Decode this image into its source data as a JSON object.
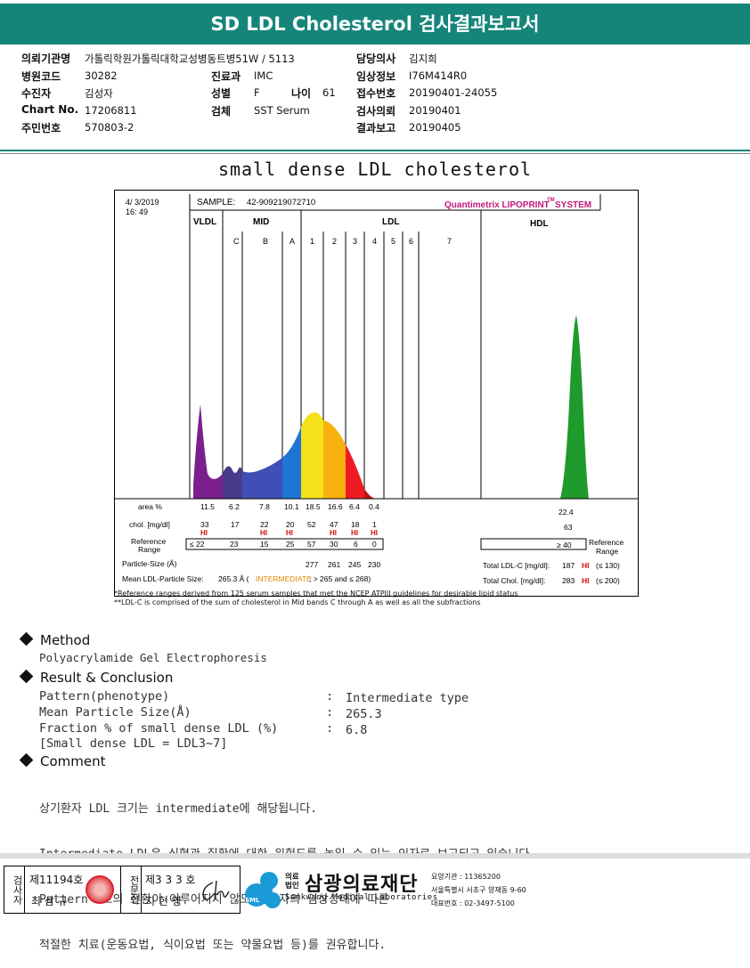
{
  "title": "SD LDL Cholesterol 검사결과보고서",
  "info": {
    "hospital_label": "의뢰기관명",
    "hospital_value": "가톨릭학원가톨릭대학교성병동트병51W / 5113",
    "doctor_label": "담당의사",
    "doctor_value": "김지희",
    "code_label": "병원코드",
    "code_value": "30282",
    "dept_label": "진료과",
    "dept_value": "IMC",
    "clinical_label": "임상정보",
    "clinical_value": "I76M414R0",
    "patient_label": "수진자",
    "patient_value": "김성자",
    "sex_label": "성별",
    "sex_value": "F",
    "age_label": "나이",
    "age_value": "61",
    "receipt_label": "접수번호",
    "receipt_value": "20190401-24055",
    "chart_label": "Chart No.",
    "chart_value": "17206811",
    "specimen_label": "검체",
    "specimen_value": "SST Serum",
    "request_label": "검사의뢰",
    "request_value": "20190401",
    "id_label": "주민번호",
    "id_value": "570803-2",
    "report_label": "결과보고",
    "report_value": "20190405"
  },
  "section_title": "small dense LDL cholesterol",
  "chart": {
    "date": "4/ 3/2019",
    "time": "16: 49",
    "sample_label": "SAMPLE:",
    "sample_value": "42-909219072710",
    "brand": "Quantimetrix LIPOPRINT",
    "brand_tm": "TM",
    "brand_system": "SYSTEM",
    "group_vldl": "VLDL",
    "group_mid": "MID",
    "group_ldl": "LDL",
    "group_hdl": "HDL",
    "band_labels": [
      "C",
      "B",
      "A",
      "1",
      "2",
      "3",
      "4",
      "5",
      "6",
      "7"
    ],
    "row_area_label": "area %",
    "area_values": [
      "11.5",
      "6.2",
      "7.8",
      "10.1",
      "18.5",
      "16.6",
      "6.4",
      "0.4"
    ],
    "area_hdl": "22.4",
    "row_chol_label": "chol. [mg/dl]",
    "chol_values": [
      "33",
      "17",
      "22",
      "20",
      "52",
      "47",
      "18",
      "1"
    ],
    "chol_hi": [
      "HI",
      "",
      "HI",
      "HI",
      "",
      "HI",
      "HI",
      "HI"
    ],
    "chol_hdl": "63",
    "row_ref_label1": "Reference",
    "row_ref_label2": "Range",
    "ref_values": [
      "≤ 22",
      "23",
      "15",
      "25",
      "57",
      "30",
      "6",
      "0"
    ],
    "ref_hdl": "≥ 40",
    "ref_right1": "Reference",
    "ref_right2": "Range",
    "particle_label": "Particle-Size (Å)",
    "particle_values": [
      "277",
      "261",
      "245",
      "230"
    ],
    "mean_label": "Mean LDL-Particle Size:",
    "mean_value": "265.3 Å (",
    "mean_type": "INTERMEDIATE",
    "mean_range": "; > 265 and ≤ 268)",
    "total_ldl_label": "Total LDL-C [mg/dl]:",
    "total_ldl_value": "187",
    "total_ldl_flag": "HI",
    "total_ldl_ref": "(≤ 130)",
    "total_chol_label": "Total Chol. [mg/dl]:",
    "total_chol_value": "283",
    "total_chol_flag": "HI",
    "total_chol_ref": "(≤ 200)",
    "note1": "*Reference ranges derived from 125 serum samples that met the NCEP ATPIII guidelines for desirable lipid status",
    "note2": "**LDL-C is comprised of the sum of cholesterol in Mid bands C through A as well as all the subfractions"
  },
  "method": {
    "heading": "Method",
    "text": "Polyacrylamide Gel Electrophoresis"
  },
  "result": {
    "heading": "Result & Conclusion",
    "pattern_label": "Pattern(phenotype)",
    "pattern_value": "Intermediate type",
    "mean_label": "Mean Particle Size(Å)",
    "mean_value": "265.3",
    "fraction_label": "Fraction % of small dense LDL (%)",
    "fraction_value": "6.8",
    "note": "[Small dense LDL = LDL3~7]",
    "colon": ":"
  },
  "comment": {
    "heading": "Comment",
    "lines": [
      "상기환자 LDL 크기는 intermediate에 해당됩니다.",
      "Intermediate LDL은 심혈관 질환에 대한 위험도를 높일 수 있는 인자로 보고되고 있습니다.",
      "Pattern B로의 전환이 이루어지지 않도록 환자의 임상상태에 따른",
      "적절한 치료(운동요법, 식이요법 또는 약물요법 등)를 권유합니다."
    ]
  },
  "footer": {
    "tester_label": "검사자",
    "tester_no": "제11194호",
    "tester_name": "최 삼 규",
    "specialist_label": "전문의",
    "specialist_no": "제3 3 3 호",
    "specialist_name": "지 현 영",
    "org_prefix_top": "의료",
    "org_prefix_bottom": "법인",
    "org_name": "삼광의료재단",
    "org_en": "Samkwang Medical Laboratories",
    "sml": "SML",
    "care_no": "요양기관 : 11365200",
    "address": "서울특별시 서초구 양재동 9-60",
    "phone": "대표번호 : 02-3497-5100"
  }
}
